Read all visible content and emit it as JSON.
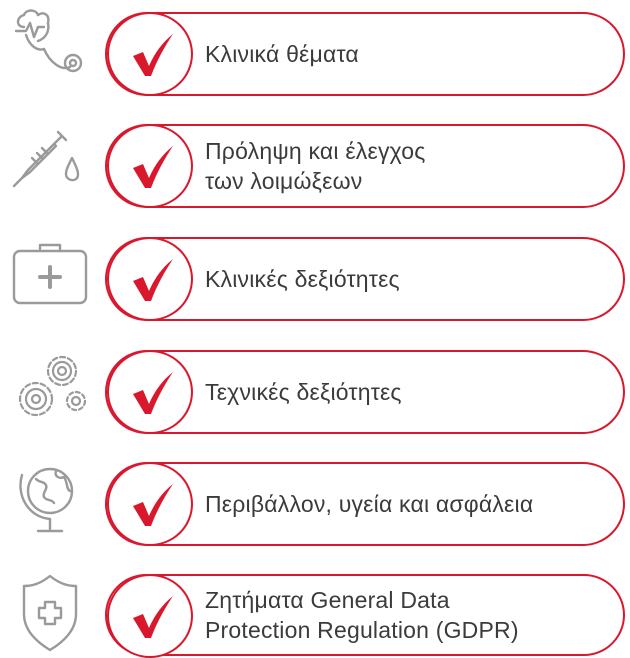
{
  "accent_color": "#d9182e",
  "icon_color": "#9a9a9a",
  "items": [
    {
      "icon": "stethoscope-icon",
      "lines": [
        "Κλινικά θέματα"
      ]
    },
    {
      "icon": "syringe-icon",
      "lines": [
        "Πρόληψη και έλεγχος",
        "των λοιμώξεων"
      ]
    },
    {
      "icon": "first-aid-kit-icon",
      "lines": [
        "Κλινικές δεξιότητες"
      ]
    },
    {
      "icon": "gears-icon",
      "lines": [
        "Τεχνικές δεξιότητες"
      ]
    },
    {
      "icon": "globe-icon",
      "lines": [
        "Περιβάλλον, υγεία και ασφάλεια"
      ]
    },
    {
      "icon": "shield-cross-icon",
      "lines": [
        "Ζητήματα General Data",
        "Protection Regulation (GDPR)"
      ]
    }
  ]
}
